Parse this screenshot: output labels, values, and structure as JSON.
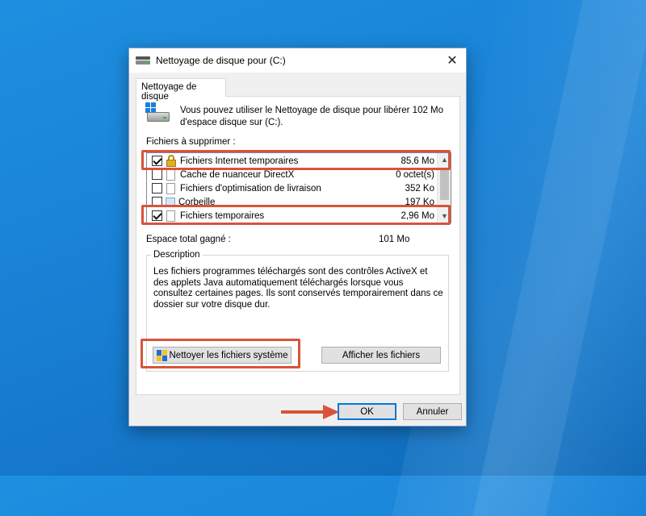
{
  "window": {
    "title": "Nettoyage de disque pour  (C:)",
    "close_glyph": "✕"
  },
  "tab": {
    "label": "Nettoyage de disque"
  },
  "intro": "Vous pouvez utiliser le Nettoyage de disque pour libérer 102 Mo d'espace disque sur  (C:).",
  "files_label": "Fichiers à supprimer :",
  "files": [
    {
      "name": "Fichiers Internet temporaires",
      "size": "85,6 Mo",
      "checked": true,
      "icon": "lock-icon"
    },
    {
      "name": "Cache de nuanceur DirectX",
      "size": "0 octet(s)",
      "checked": false,
      "icon": "file-icon"
    },
    {
      "name": "Fichiers d'optimisation de livraison",
      "size": "352 Ko",
      "checked": false,
      "icon": "file-icon"
    },
    {
      "name": "Corbeille",
      "size": "197 Ko",
      "checked": false,
      "icon": "recycle-bin-icon"
    },
    {
      "name": "Fichiers temporaires",
      "size": "2,96 Mo",
      "checked": true,
      "icon": "file-icon"
    }
  ],
  "total_gain": {
    "label": "Espace total gagné :",
    "value": "101 Mo"
  },
  "description": {
    "legend": "Description",
    "text": "Les fichiers programmes téléchargés sont des contrôles ActiveX et des applets Java automatiquement téléchargés lorsque vous consultez certaines pages. Ils sont conservés temporairement dans ce dossier sur votre disque dur."
  },
  "buttons": {
    "clean_system": "Nettoyer les fichiers système",
    "view_files": "Afficher les fichiers",
    "ok": "OK",
    "cancel": "Annuler"
  },
  "colors": {
    "annotation": "#d9533a",
    "accent": "#0078d7",
    "desktop": "#1a84d8"
  }
}
